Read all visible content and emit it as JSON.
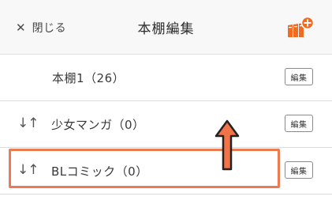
{
  "header": {
    "close_icon": "close-icon",
    "close_label": "閉じる",
    "title": "本棚編集",
    "add_shelf_icon": "add-bookshelf-icon",
    "accent_color": "#f26b22"
  },
  "shelves": [
    {
      "name": "本棚1（26）",
      "edit_label": "編集",
      "sortable": false
    },
    {
      "name": "少女マンガ（0）",
      "edit_label": "編集",
      "sortable": true
    },
    {
      "name": "BLコミック（0）",
      "edit_label": "編集",
      "sortable": true
    }
  ],
  "sort_handle_glyph": "↓↑",
  "annotation": {
    "highlight_color": "#ec7b52",
    "arrow_color": "#f07448"
  }
}
